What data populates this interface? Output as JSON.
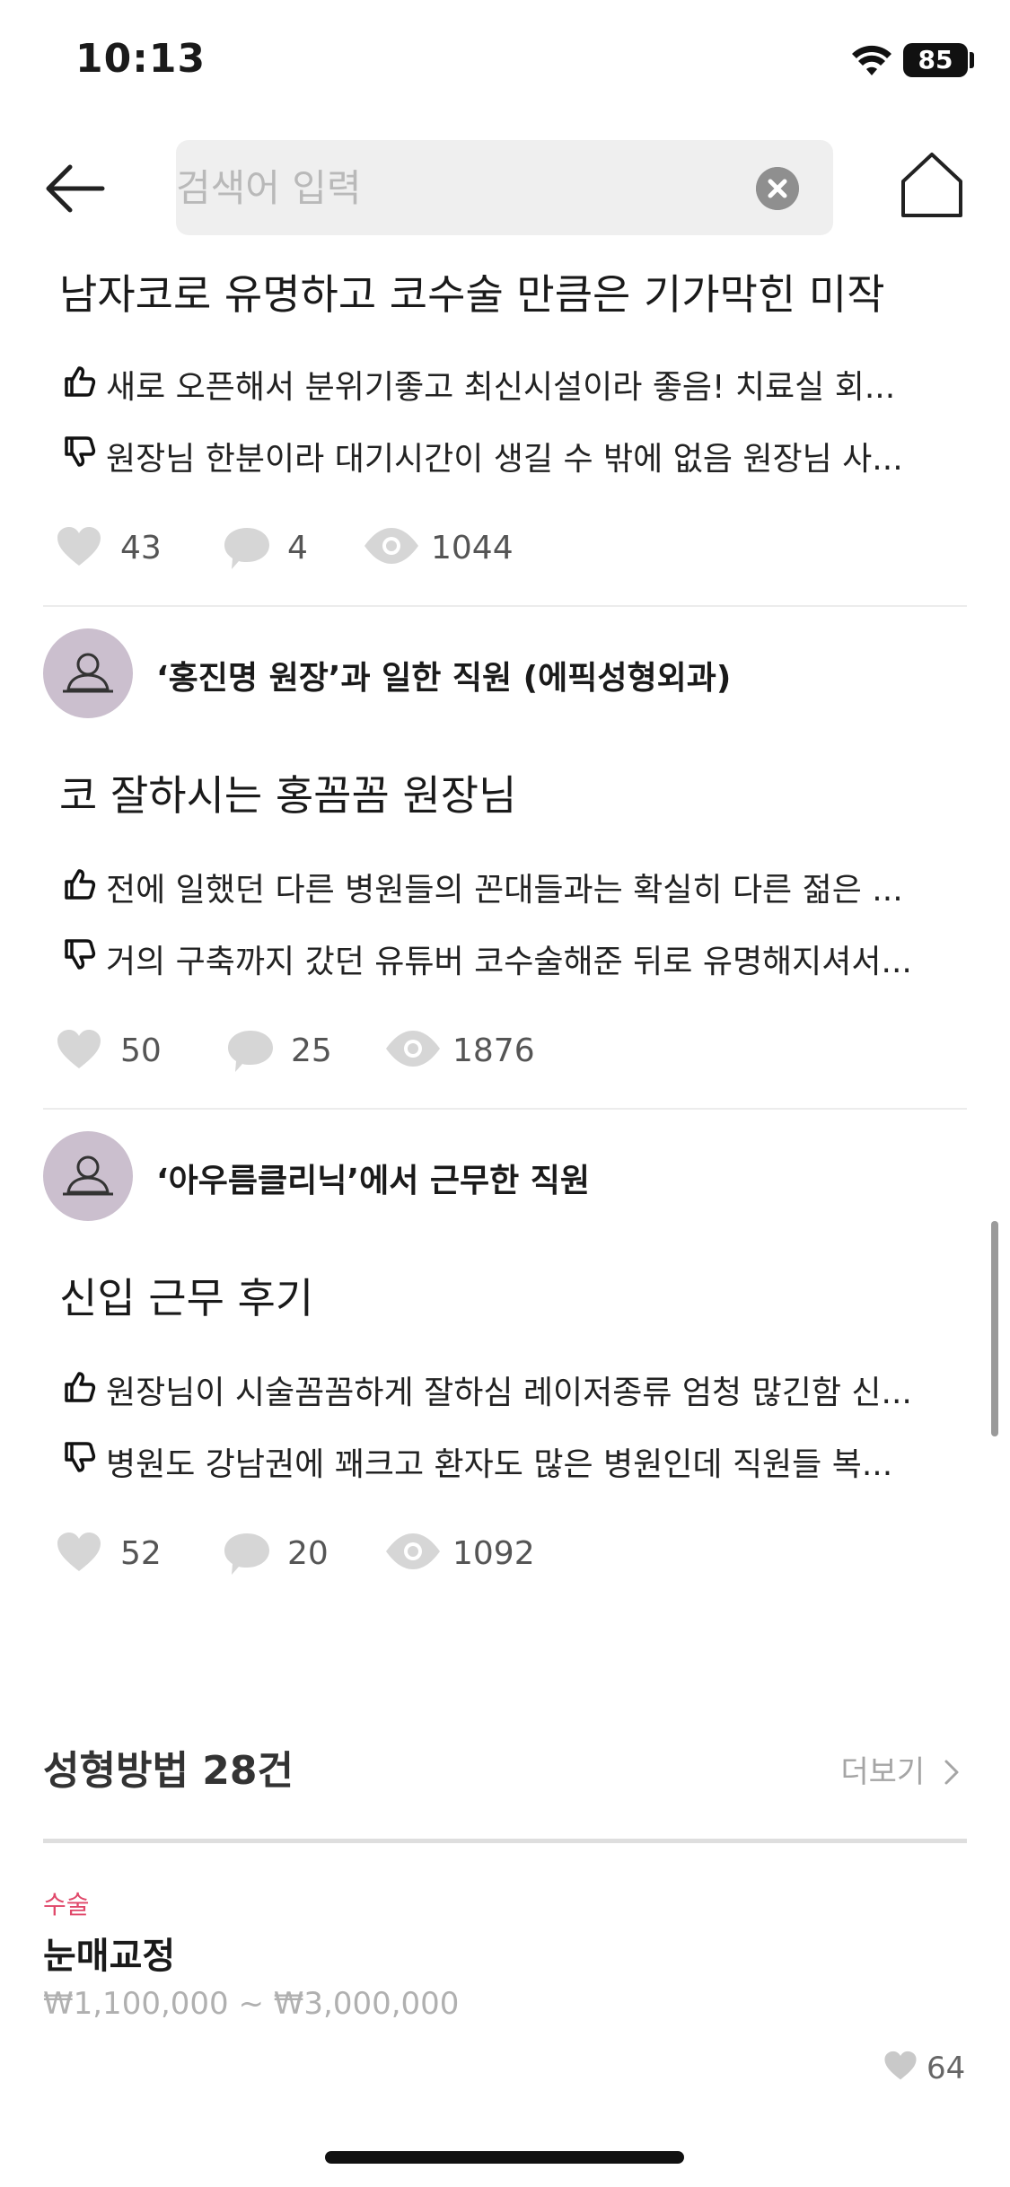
{
  "status": {
    "time": "10:13",
    "battery": "85"
  },
  "search": {
    "placeholder": "검색어 입력",
    "value": ""
  },
  "reviews": [
    {
      "author": "",
      "title": "남자코로 유명하고 코수술 만큼은 기가막힌 미작",
      "pros": "새로 오픈해서 분위기좋고 최신시설이라 좋음! 치료실 회...",
      "cons": "원장님 한분이라 대기시간이 생길 수 밖에 없음 원장님 사...",
      "likes": "43",
      "comments": "4",
      "views": "1044"
    },
    {
      "author": "‘홍진명 원장’과 일한 직원 (에픽성형외과)",
      "title": "코 잘하시는 홍꼼꼼 원장님",
      "pros": "전에 일했던 다른 병원들의 꼰대들과는 확실히 다른 젊은 ...",
      "cons": "거의 구축까지 갔던 유튜버 코수술해준 뒤로 유명해지셔서...",
      "likes": "50",
      "comments": "25",
      "views": "1876"
    },
    {
      "author": "‘아우름클리닉’에서 근무한 직원",
      "title": "신입 근무 후기",
      "pros": "원장님이 시술꼼꼼하게 잘하심 레이저종류 엄청 많긴함 신...",
      "cons": "병원도 강남권에 꽤크고 환자도 많은 병원인데 직원들 복...",
      "likes": "52",
      "comments": "20",
      "views": "1092"
    }
  ],
  "procedures": {
    "title": "성형방법  28건",
    "more": "더보기",
    "items": [
      {
        "category": "수술",
        "name": "눈매교정",
        "price": "₩1,100,000 ~ ₩3,000,000",
        "likes": "64"
      }
    ]
  },
  "colors": {
    "accent": "#e0486a",
    "avatar": "#cbbfce",
    "divider": "#ececec"
  },
  "icons": [
    "back-arrow-icon",
    "clear-icon",
    "home-icon",
    "thumbs-up-icon",
    "thumbs-down-icon",
    "heart-icon",
    "comment-icon",
    "eye-icon",
    "chevron-right-icon",
    "wifi-icon"
  ]
}
